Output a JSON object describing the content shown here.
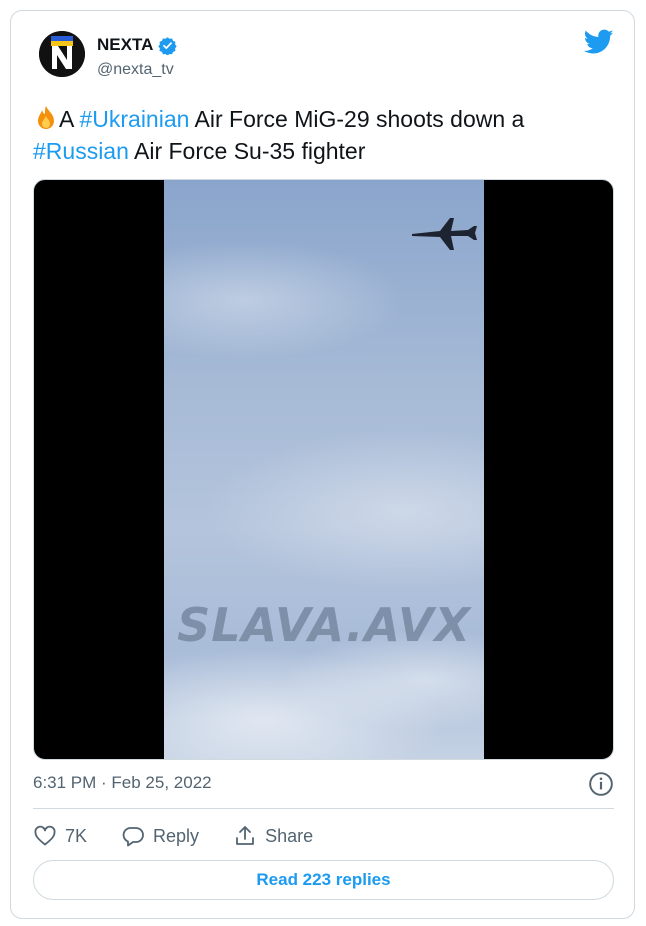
{
  "author": {
    "name": "NEXTA",
    "handle": "@nexta_tv",
    "verified": true,
    "avatar_letter": "N"
  },
  "tweet": {
    "emoji": "fire-icon",
    "text_part1": "A ",
    "tag1": "#Ukrainian",
    "text_part2": " Air Force MiG-29 shoots down a ",
    "tag2": "#Russian",
    "text_part3": " Air Force Su-35 fighter"
  },
  "media": {
    "watermark": "SLAVA.AVX"
  },
  "timestamp": "6:31 PM · Feb 25, 2022",
  "actions": {
    "like_count": "7K",
    "reply_label": "Reply",
    "share_label": "Share"
  },
  "read_replies": "Read 223 replies",
  "colors": {
    "accent": "#1d9bf0",
    "text": "#0f1419",
    "secondary": "#536471",
    "border": "#cfd9de"
  }
}
